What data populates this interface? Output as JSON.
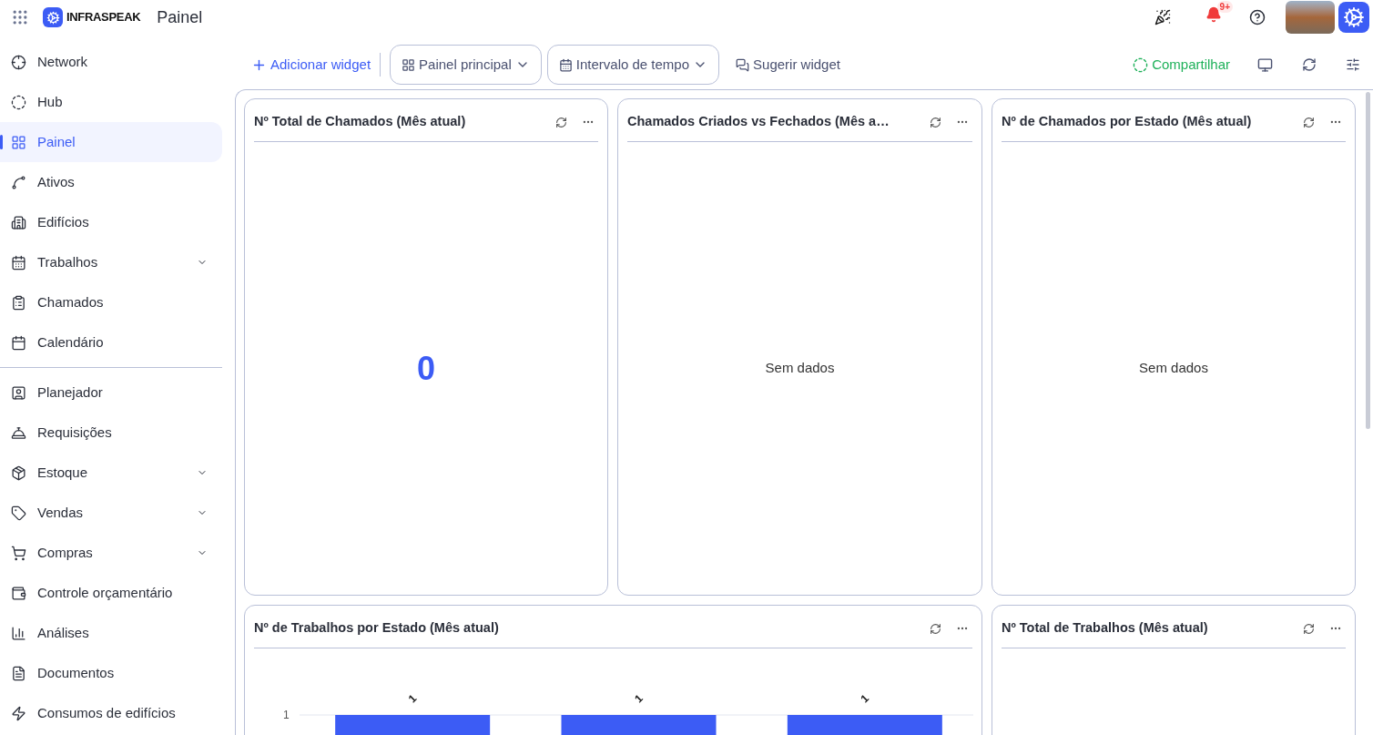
{
  "header": {
    "brand": "INFRASPEAK",
    "page_title": "Painel",
    "notifications_badge": "9+"
  },
  "sidebar": {
    "groups": [
      [
        {
          "label": "Network",
          "selected": false,
          "submenu": false
        },
        {
          "label": "Hub",
          "selected": false,
          "submenu": false
        },
        {
          "label": "Painel",
          "selected": true,
          "submenu": false
        },
        {
          "label": "Ativos",
          "selected": false,
          "submenu": false
        },
        {
          "label": "Edifícios",
          "selected": false,
          "submenu": false
        },
        {
          "label": "Trabalhos",
          "selected": false,
          "submenu": true
        },
        {
          "label": "Chamados",
          "selected": false,
          "submenu": false
        },
        {
          "label": "Calendário",
          "selected": false,
          "submenu": false
        }
      ],
      [
        {
          "label": "Planejador",
          "selected": false,
          "submenu": false
        },
        {
          "label": "Requisições",
          "selected": false,
          "submenu": false
        },
        {
          "label": "Estoque",
          "selected": false,
          "submenu": true
        },
        {
          "label": "Vendas",
          "selected": false,
          "submenu": true
        },
        {
          "label": "Compras",
          "selected": false,
          "submenu": true
        },
        {
          "label": "Controle orçamentário",
          "selected": false,
          "submenu": false
        },
        {
          "label": "Análises",
          "selected": false,
          "submenu": false
        },
        {
          "label": "Documentos",
          "selected": false,
          "submenu": false
        },
        {
          "label": "Consumos de edifícios",
          "selected": false,
          "submenu": false
        }
      ]
    ]
  },
  "toolbar": {
    "add_widget": "Adicionar widget",
    "dashboard_select": "Painel principal",
    "time_range_select": "Intervalo de tempo",
    "suggest_widget": "Sugerir widget",
    "share": "Compartilhar"
  },
  "widgets": [
    {
      "kind": "number",
      "title": "Nº Total de Chamados (Mês atual)",
      "value": "0"
    },
    {
      "kind": "empty",
      "title": "Chamados Criados vs Fechados (Mês a…",
      "message": "Sem dados"
    },
    {
      "kind": "empty",
      "title": "Nº de Chamados por Estado (Mês atual)",
      "message": "Sem dados"
    },
    {
      "kind": "bar",
      "title": "Nº de Trabalhos por Estado (Mês atual)",
      "axis_tick": "1",
      "bar_labels": [
        "1",
        "1",
        "1"
      ]
    },
    {
      "kind": "empty",
      "title": "Nº Total de Trabalhos (Mês atual)"
    }
  ]
}
